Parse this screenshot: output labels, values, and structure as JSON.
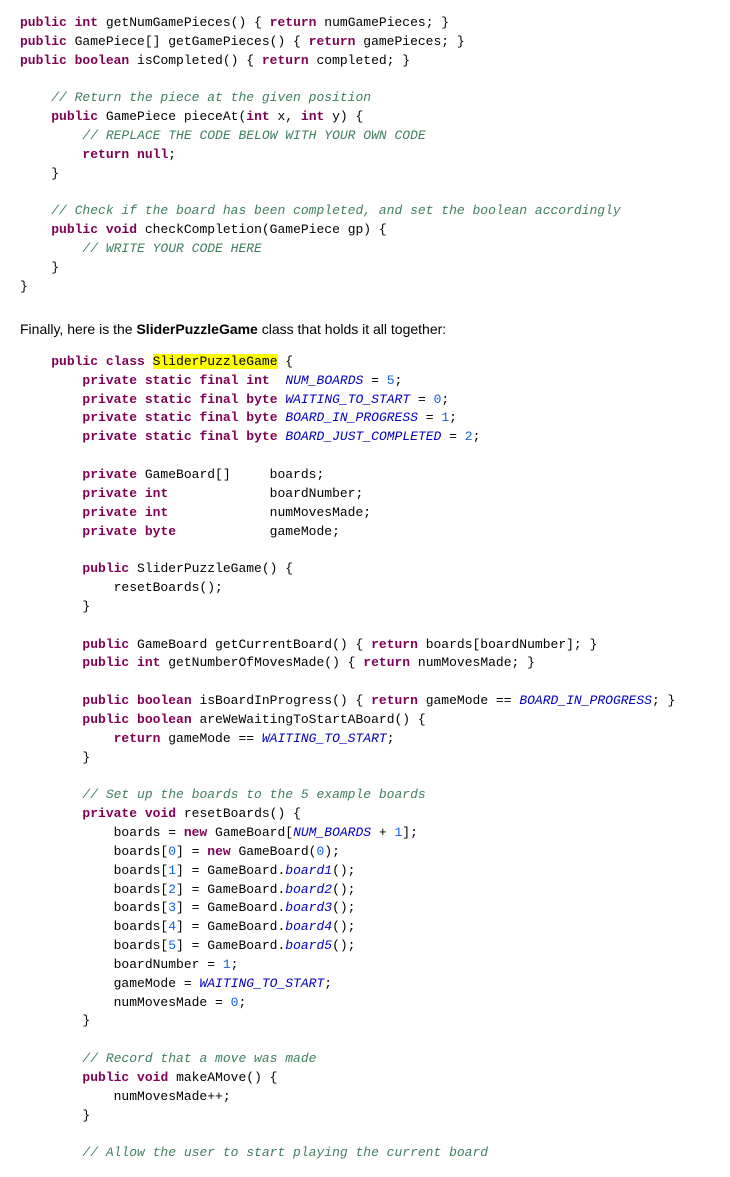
{
  "prose": {
    "line1": "Finally, here is the ",
    "classname": "SliderPuzzleGame",
    "line2": " class that holds it all together:"
  },
  "code_before": [
    {
      "indent": 2,
      "parts": [
        {
          "t": "kw",
          "v": "public"
        },
        {
          "t": "",
          "v": " "
        },
        {
          "t": "type",
          "v": "int"
        },
        {
          "t": "",
          "v": " getNumGamePieces() { "
        },
        {
          "t": "ret",
          "v": "return"
        },
        {
          "t": "",
          "v": " numGamePieces; }"
        }
      ]
    },
    {
      "indent": 2,
      "parts": [
        {
          "t": "kw",
          "v": "public"
        },
        {
          "t": "",
          "v": " GamePiece[] getGamePieces() { "
        },
        {
          "t": "ret",
          "v": "return"
        },
        {
          "t": "",
          "v": " gamePieces; }"
        }
      ]
    },
    {
      "indent": 2,
      "parts": [
        {
          "t": "kw",
          "v": "public"
        },
        {
          "t": "",
          "v": " "
        },
        {
          "t": "type",
          "v": "boolean"
        },
        {
          "t": "",
          "v": " isCompleted() { "
        },
        {
          "t": "ret",
          "v": "return"
        },
        {
          "t": "",
          "v": " completed; }"
        }
      ]
    },
    {
      "indent": 0,
      "parts": [
        {
          "t": "",
          "v": ""
        }
      ]
    },
    {
      "indent": 2,
      "parts": [
        {
          "t": "cm",
          "v": "// Return the piece at the given position"
        }
      ]
    },
    {
      "indent": 2,
      "parts": [
        {
          "t": "kw",
          "v": "public"
        },
        {
          "t": "",
          "v": " GamePiece pieceAt("
        },
        {
          "t": "type",
          "v": "int"
        },
        {
          "t": "",
          "v": " x, "
        },
        {
          "t": "type",
          "v": "int"
        },
        {
          "t": "",
          "v": " y) {"
        }
      ]
    },
    {
      "indent": 3,
      "parts": [
        {
          "t": "cm",
          "v": "// REPLACE THE CODE BELOW WITH YOUR OWN CODE"
        }
      ]
    },
    {
      "indent": 3,
      "parts": [
        {
          "t": "ret",
          "v": "return"
        },
        {
          "t": "",
          "v": " "
        },
        {
          "t": "kw",
          "v": "null"
        },
        {
          "t": "",
          "v": ";"
        }
      ]
    },
    {
      "indent": 2,
      "parts": [
        {
          "t": "",
          "v": "}"
        }
      ]
    },
    {
      "indent": 0,
      "parts": [
        {
          "t": "",
          "v": ""
        }
      ]
    },
    {
      "indent": 2,
      "parts": [
        {
          "t": "cm",
          "v": "// Check if the board has been completed, and set the boolean accordingly"
        }
      ]
    },
    {
      "indent": 2,
      "parts": [
        {
          "t": "kw",
          "v": "public"
        },
        {
          "t": "",
          "v": " "
        },
        {
          "t": "type",
          "v": "void"
        },
        {
          "t": "",
          "v": " checkCompletion(GamePiece gp) {"
        }
      ]
    },
    {
      "indent": 3,
      "parts": [
        {
          "t": "cm",
          "v": "// WRITE YOUR CODE HERE"
        }
      ]
    },
    {
      "indent": 2,
      "parts": [
        {
          "t": "",
          "v": "}"
        }
      ]
    },
    {
      "indent": 1,
      "parts": [
        {
          "t": "",
          "v": "}"
        }
      ]
    }
  ],
  "code_main": [
    {
      "indent": 1,
      "parts": [
        {
          "t": "kw",
          "v": "public"
        },
        {
          "t": "",
          "v": " "
        },
        {
          "t": "kw",
          "v": "class"
        },
        {
          "t": "",
          "v": " "
        },
        {
          "t": "highlight",
          "v": "SliderPuzzleGame"
        },
        {
          "t": "",
          "v": " {"
        }
      ]
    },
    {
      "indent": 2,
      "parts": [
        {
          "t": "kw",
          "v": "private"
        },
        {
          "t": "",
          "v": " "
        },
        {
          "t": "kw",
          "v": "static"
        },
        {
          "t": "",
          "v": " "
        },
        {
          "t": "kw",
          "v": "final"
        },
        {
          "t": "",
          "v": " "
        },
        {
          "t": "type",
          "v": "int"
        },
        {
          "t": "",
          "v": "  "
        },
        {
          "t": "const-name",
          "v": "NUM_BOARDS"
        },
        {
          "t": "",
          "v": " = "
        },
        {
          "t": "num",
          "v": "5"
        },
        {
          "t": "",
          "v": ";"
        }
      ]
    },
    {
      "indent": 2,
      "parts": [
        {
          "t": "kw",
          "v": "private"
        },
        {
          "t": "",
          "v": " "
        },
        {
          "t": "kw",
          "v": "static"
        },
        {
          "t": "",
          "v": " "
        },
        {
          "t": "kw",
          "v": "final"
        },
        {
          "t": "",
          "v": " "
        },
        {
          "t": "type",
          "v": "byte"
        },
        {
          "t": "",
          "v": " "
        },
        {
          "t": "const-name",
          "v": "WAITING_TO_START"
        },
        {
          "t": "",
          "v": " = "
        },
        {
          "t": "num",
          "v": "0"
        },
        {
          "t": "",
          "v": ";"
        }
      ]
    },
    {
      "indent": 2,
      "parts": [
        {
          "t": "kw",
          "v": "private"
        },
        {
          "t": "",
          "v": " "
        },
        {
          "t": "kw",
          "v": "static"
        },
        {
          "t": "",
          "v": " "
        },
        {
          "t": "kw",
          "v": "final"
        },
        {
          "t": "",
          "v": " "
        },
        {
          "t": "type",
          "v": "byte"
        },
        {
          "t": "",
          "v": " "
        },
        {
          "t": "const-name",
          "v": "BOARD_IN_PROGRESS"
        },
        {
          "t": "",
          "v": " = "
        },
        {
          "t": "num",
          "v": "1"
        },
        {
          "t": "",
          "v": ";"
        }
      ]
    },
    {
      "indent": 2,
      "parts": [
        {
          "t": "kw",
          "v": "private"
        },
        {
          "t": "",
          "v": " "
        },
        {
          "t": "kw",
          "v": "static"
        },
        {
          "t": "",
          "v": " "
        },
        {
          "t": "kw",
          "v": "final"
        },
        {
          "t": "",
          "v": " "
        },
        {
          "t": "type",
          "v": "byte"
        },
        {
          "t": "",
          "v": " "
        },
        {
          "t": "const-name",
          "v": "BOARD_JUST_COMPLETED"
        },
        {
          "t": "",
          "v": " = "
        },
        {
          "t": "num",
          "v": "2"
        },
        {
          "t": "",
          "v": ";"
        }
      ]
    },
    {
      "indent": 0,
      "parts": [
        {
          "t": "",
          "v": ""
        }
      ]
    },
    {
      "indent": 2,
      "parts": [
        {
          "t": "kw",
          "v": "private"
        },
        {
          "t": "",
          "v": " GameBoard[]     boards;"
        }
      ]
    },
    {
      "indent": 2,
      "parts": [
        {
          "t": "kw",
          "v": "private"
        },
        {
          "t": "",
          "v": " "
        },
        {
          "t": "type",
          "v": "int"
        },
        {
          "t": "",
          "v": "             boardNumber;"
        }
      ]
    },
    {
      "indent": 2,
      "parts": [
        {
          "t": "kw",
          "v": "private"
        },
        {
          "t": "",
          "v": " "
        },
        {
          "t": "type",
          "v": "int"
        },
        {
          "t": "",
          "v": "             numMovesMade;"
        }
      ]
    },
    {
      "indent": 2,
      "parts": [
        {
          "t": "kw",
          "v": "private"
        },
        {
          "t": "",
          "v": " "
        },
        {
          "t": "type",
          "v": "byte"
        },
        {
          "t": "",
          "v": "            gameMode;"
        }
      ]
    },
    {
      "indent": 0,
      "parts": [
        {
          "t": "",
          "v": ""
        }
      ]
    },
    {
      "indent": 2,
      "parts": [
        {
          "t": "kw",
          "v": "public"
        },
        {
          "t": "",
          "v": " SliderPuzzleGame() {"
        }
      ]
    },
    {
      "indent": 3,
      "parts": [
        {
          "t": "",
          "v": "resetBoards();"
        }
      ]
    },
    {
      "indent": 2,
      "parts": [
        {
          "t": "",
          "v": "}"
        }
      ]
    },
    {
      "indent": 0,
      "parts": [
        {
          "t": "",
          "v": ""
        }
      ]
    },
    {
      "indent": 2,
      "parts": [
        {
          "t": "kw",
          "v": "public"
        },
        {
          "t": "",
          "v": " GameBoard getCurrentBoard() { "
        },
        {
          "t": "ret",
          "v": "return"
        },
        {
          "t": "",
          "v": " boards[boardNumber]; }"
        }
      ]
    },
    {
      "indent": 2,
      "parts": [
        {
          "t": "kw",
          "v": "public"
        },
        {
          "t": "",
          "v": " "
        },
        {
          "t": "type",
          "v": "int"
        },
        {
          "t": "",
          "v": " getNumberOfMovesMade() { "
        },
        {
          "t": "ret",
          "v": "return"
        },
        {
          "t": "",
          "v": " numMovesMade; }"
        }
      ]
    },
    {
      "indent": 0,
      "parts": [
        {
          "t": "",
          "v": ""
        }
      ]
    },
    {
      "indent": 2,
      "parts": [
        {
          "t": "kw",
          "v": "public"
        },
        {
          "t": "",
          "v": " "
        },
        {
          "t": "type",
          "v": "boolean"
        },
        {
          "t": "",
          "v": " isBoardInProgress() { "
        },
        {
          "t": "ret",
          "v": "return"
        },
        {
          "t": "",
          "v": " gameMode == "
        },
        {
          "t": "const-name",
          "v": "BOARD_IN_PROGRESS"
        },
        {
          "t": "",
          "v": "; }"
        }
      ]
    },
    {
      "indent": 2,
      "parts": [
        {
          "t": "kw",
          "v": "public"
        },
        {
          "t": "",
          "v": " "
        },
        {
          "t": "type",
          "v": "boolean"
        },
        {
          "t": "",
          "v": " areWeWaitingToStartABoard() {"
        }
      ]
    },
    {
      "indent": 3,
      "parts": [
        {
          "t": "ret",
          "v": "return"
        },
        {
          "t": "",
          "v": " gameMode == "
        },
        {
          "t": "const-name",
          "v": "WAITING_TO_START"
        },
        {
          "t": "",
          "v": ";"
        }
      ]
    },
    {
      "indent": 2,
      "parts": [
        {
          "t": "",
          "v": "}"
        }
      ]
    },
    {
      "indent": 0,
      "parts": [
        {
          "t": "",
          "v": ""
        }
      ]
    },
    {
      "indent": 2,
      "parts": [
        {
          "t": "cm",
          "v": "// Set up the boards to the 5 example boards"
        }
      ]
    },
    {
      "indent": 2,
      "parts": [
        {
          "t": "kw",
          "v": "private"
        },
        {
          "t": "",
          "v": " "
        },
        {
          "t": "type",
          "v": "void"
        },
        {
          "t": "",
          "v": " resetBoards() {"
        }
      ]
    },
    {
      "indent": 3,
      "parts": [
        {
          "t": "",
          "v": "boards = "
        },
        {
          "t": "kw",
          "v": "new"
        },
        {
          "t": "",
          "v": " GameBoard["
        },
        {
          "t": "const-name",
          "v": "NUM_BOARDS"
        },
        {
          "t": "",
          "v": " + "
        },
        {
          "t": "num",
          "v": "1"
        },
        {
          "t": "",
          "v": "];"
        }
      ]
    },
    {
      "indent": 3,
      "parts": [
        {
          "t": "",
          "v": "boards["
        },
        {
          "t": "num",
          "v": "0"
        },
        {
          "t": "",
          "v": "] = "
        },
        {
          "t": "kw",
          "v": "new"
        },
        {
          "t": "",
          "v": " GameBoard("
        },
        {
          "t": "num",
          "v": "0"
        },
        {
          "t": "",
          "v": ");"
        }
      ]
    },
    {
      "indent": 3,
      "parts": [
        {
          "t": "",
          "v": "boards["
        },
        {
          "t": "num",
          "v": "1"
        },
        {
          "t": "",
          "v": "] = GameBoard."
        },
        {
          "t": "const-name",
          "v": "board1"
        },
        {
          "t": "",
          "v": "();"
        }
      ]
    },
    {
      "indent": 3,
      "parts": [
        {
          "t": "",
          "v": "boards["
        },
        {
          "t": "num",
          "v": "2"
        },
        {
          "t": "",
          "v": "] = GameBoard."
        },
        {
          "t": "const-name",
          "v": "board2"
        },
        {
          "t": "",
          "v": "();"
        }
      ]
    },
    {
      "indent": 3,
      "parts": [
        {
          "t": "",
          "v": "boards["
        },
        {
          "t": "num",
          "v": "3"
        },
        {
          "t": "",
          "v": "] = GameBoard."
        },
        {
          "t": "const-name",
          "v": "board3"
        },
        {
          "t": "",
          "v": "();"
        }
      ]
    },
    {
      "indent": 3,
      "parts": [
        {
          "t": "",
          "v": "boards["
        },
        {
          "t": "num",
          "v": "4"
        },
        {
          "t": "",
          "v": "] = GameBoard."
        },
        {
          "t": "const-name",
          "v": "board4"
        },
        {
          "t": "",
          "v": "();"
        }
      ]
    },
    {
      "indent": 3,
      "parts": [
        {
          "t": "",
          "v": "boards["
        },
        {
          "t": "num",
          "v": "5"
        },
        {
          "t": "",
          "v": "] = GameBoard."
        },
        {
          "t": "const-name",
          "v": "board5"
        },
        {
          "t": "",
          "v": "();"
        }
      ]
    },
    {
      "indent": 3,
      "parts": [
        {
          "t": "",
          "v": "boardNumber = "
        },
        {
          "t": "num",
          "v": "1"
        },
        {
          "t": "",
          "v": ";"
        }
      ]
    },
    {
      "indent": 3,
      "parts": [
        {
          "t": "",
          "v": "gameMode = "
        },
        {
          "t": "const-name",
          "v": "WAITING_TO_START"
        },
        {
          "t": "",
          "v": ";"
        }
      ]
    },
    {
      "indent": 3,
      "parts": [
        {
          "t": "",
          "v": "numMovesMade = "
        },
        {
          "t": "num",
          "v": "0"
        },
        {
          "t": "",
          "v": ";"
        }
      ]
    },
    {
      "indent": 2,
      "parts": [
        {
          "t": "",
          "v": "}"
        }
      ]
    },
    {
      "indent": 0,
      "parts": [
        {
          "t": "",
          "v": ""
        }
      ]
    },
    {
      "indent": 2,
      "parts": [
        {
          "t": "cm",
          "v": "// Record that a move was made"
        }
      ]
    },
    {
      "indent": 2,
      "parts": [
        {
          "t": "kw",
          "v": "public"
        },
        {
          "t": "",
          "v": " "
        },
        {
          "t": "type",
          "v": "void"
        },
        {
          "t": "",
          "v": " makeAMove() {"
        }
      ]
    },
    {
      "indent": 3,
      "parts": [
        {
          "t": "",
          "v": "numMovesMade++;"
        }
      ]
    },
    {
      "indent": 2,
      "parts": [
        {
          "t": "",
          "v": "}"
        }
      ]
    },
    {
      "indent": 0,
      "parts": [
        {
          "t": "",
          "v": ""
        }
      ]
    },
    {
      "indent": 2,
      "parts": [
        {
          "t": "cm",
          "v": "// Allow the user to start playing the current board"
        }
      ]
    }
  ]
}
